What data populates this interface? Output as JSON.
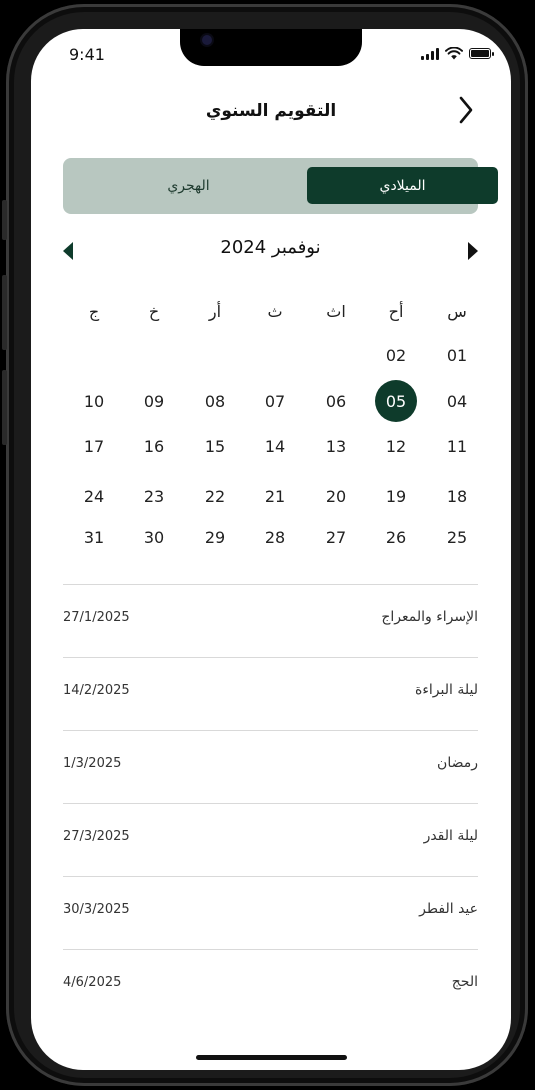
{
  "status_bar": {
    "time": "9:41"
  },
  "header": {
    "title": "التقويم السنوي",
    "back_icon": "chevron-icon"
  },
  "segmented": {
    "gregorian_label": "الميلادي",
    "hijri_label": "الهجري",
    "selected": "gregorian"
  },
  "month_nav": {
    "label": "نوفمبر 2024",
    "prev_icon": "triangle-left-icon",
    "next_icon": "triangle-right-icon"
  },
  "calendar": {
    "weekdays": [
      "س",
      "أح",
      "اث",
      "ث",
      "أر",
      "خ",
      "ج"
    ],
    "weeks": [
      [
        "01",
        "02",
        "",
        "",
        "",
        "",
        ""
      ],
      [
        "04",
        "05",
        "06",
        "07",
        "08",
        "09",
        "10"
      ],
      [
        "11",
        "12",
        "13",
        "14",
        "15",
        "16",
        "17"
      ],
      [
        "18",
        "19",
        "20",
        "21",
        "22",
        "23",
        "24"
      ],
      [
        "25",
        "26",
        "27",
        "28",
        "29",
        "30",
        "31"
      ]
    ],
    "selected_day": "05"
  },
  "events": [
    {
      "name": "الإسراء والمعراج",
      "date": "27/1/2025"
    },
    {
      "name": "ليلة البراءة",
      "date": "14/2/2025"
    },
    {
      "name": "رمضان",
      "date": "1/3/2025"
    },
    {
      "name": "ليلة القدر",
      "date": "27/3/2025"
    },
    {
      "name": "عيد الفطر",
      "date": "30/3/2025"
    },
    {
      "name": "الحج",
      "date": "4/6/2025"
    }
  ],
  "colors": {
    "primary": "#0e3b2b",
    "segment_bg": "#b8c7c0",
    "divider": "#d9d9d9"
  }
}
